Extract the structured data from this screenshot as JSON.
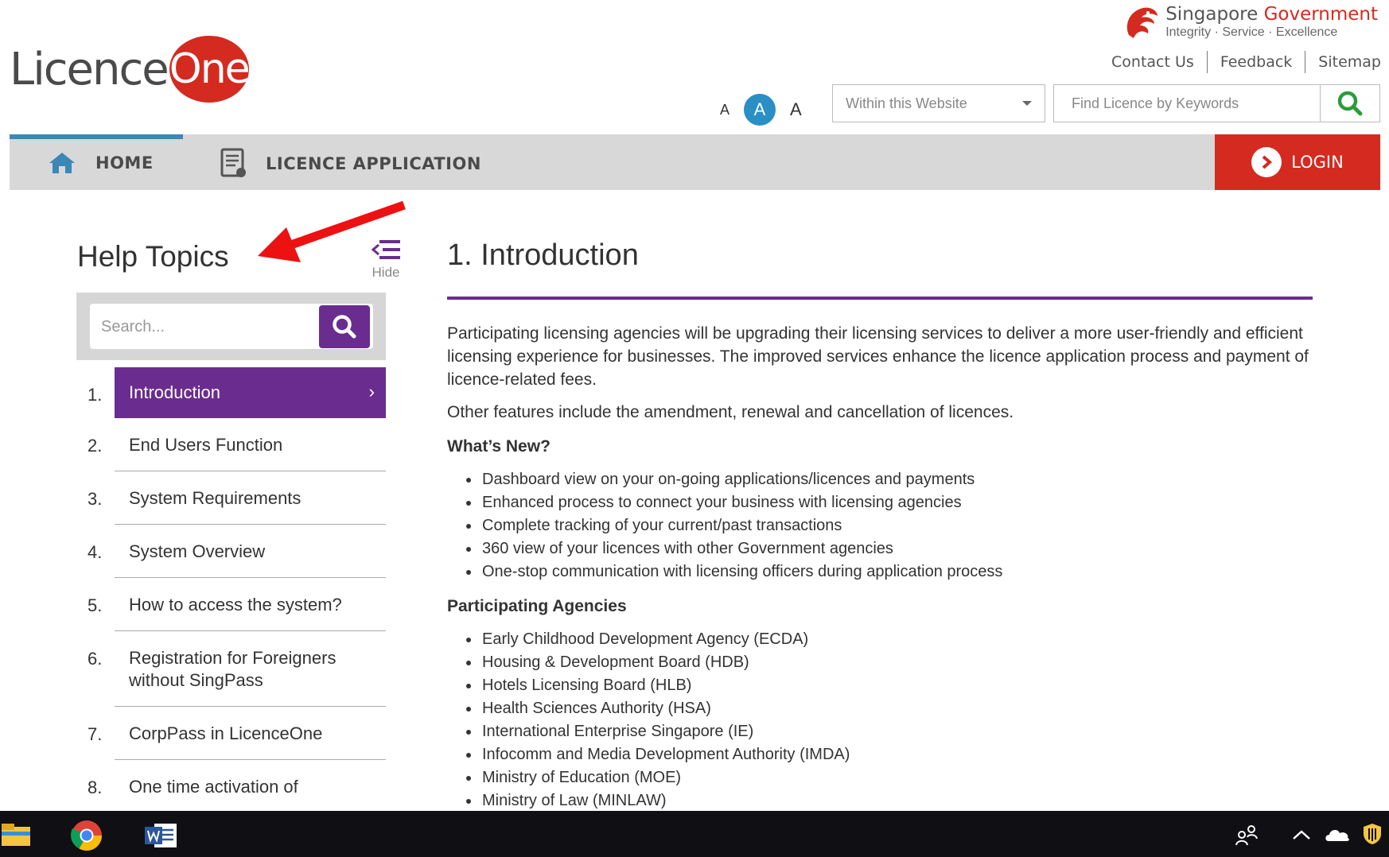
{
  "brand": {
    "logo_part1": "Licence",
    "logo_part2": "One"
  },
  "gov": {
    "name_part1": "Singapore",
    "name_part2": "Government",
    "tagline": "Integrity · Service · Excellence"
  },
  "top_links": [
    "Contact Us",
    "Feedback",
    "Sitemap"
  ],
  "font_size": {
    "small": "A",
    "medium": "A",
    "large": "A"
  },
  "search_scope": {
    "selected": "Within this Website"
  },
  "keyword_search": {
    "placeholder": "Find Licence by Keywords"
  },
  "nav": {
    "home": "HOME",
    "licence_application": "LICENCE APPLICATION",
    "login": "LOGIN"
  },
  "sidebar": {
    "title": "Help Topics",
    "hide_label": "Hide",
    "search_placeholder": "Search...",
    "topics": [
      {
        "num": "1.",
        "label": "Introduction"
      },
      {
        "num": "2.",
        "label": "End Users Function"
      },
      {
        "num": "3.",
        "label": "System Requirements"
      },
      {
        "num": "4.",
        "label": "System Overview"
      },
      {
        "num": "5.",
        "label": "How to access the system?"
      },
      {
        "num": "6.",
        "label": "Registration for Foreigners without SingPass"
      },
      {
        "num": "7.",
        "label": "CorpPass in LicenceOne"
      },
      {
        "num": "8.",
        "label": "One time activation of"
      }
    ]
  },
  "content": {
    "title": "1. Introduction",
    "para1": "Participating licensing agencies will be upgrading their licensing services to deliver a more user-friendly and efficient licensing experience for businesses. The improved services enhance the licence application process and payment of licence-related fees.",
    "para2": "Other features include the amendment, renewal and cancellation of licences.",
    "whats_new_heading": "What’s New?",
    "whats_new": [
      "Dashboard view on your on-going applications/licences and payments",
      "Enhanced process to connect your business with licensing agencies",
      "Complete tracking of your current/past transactions",
      "360 view of your licences with other Government agencies",
      "One-stop communication with licensing officers during application process"
    ],
    "agencies_heading": "Participating Agencies",
    "agencies": [
      "Early Childhood Development Agency (ECDA)",
      "Housing & Development Board (HDB)",
      "Hotels Licensing Board (HLB)",
      "Health Sciences Authority (HSA)",
      "International Enterprise Singapore (IE)",
      "Infocomm and Media Development Authority (IMDA)",
      "Ministry of Education (MOE)",
      "Ministry of Law (MINLAW)"
    ]
  },
  "colors": {
    "brand_red": "#d42a1f",
    "purple": "#6b2c8f",
    "blue": "#3b87b5",
    "green": "#2e9b3a"
  },
  "taskbar_icons": [
    "file-explorer-icon",
    "chrome-icon",
    "word-icon",
    "people-icon",
    "chevron-up-icon",
    "onedrive-icon",
    "security-icon"
  ]
}
